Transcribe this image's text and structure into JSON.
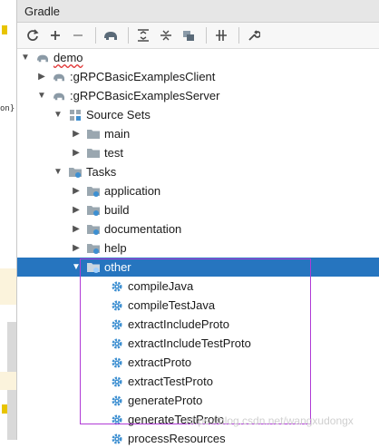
{
  "panel": {
    "title": "Gradle"
  },
  "editor": {
    "code_fragment": "on}"
  },
  "toolbar": {
    "buttons": [
      {
        "name": "refresh-icon",
        "glyph": "⟳"
      },
      {
        "name": "add-icon",
        "glyph": "+"
      },
      {
        "name": "remove-icon",
        "glyph": "−"
      },
      {
        "name": "elephant-icon",
        "glyph": "🐘"
      },
      {
        "name": "expand-all-icon",
        "glyph": "⇳"
      },
      {
        "name": "collapse-all-icon",
        "glyph": "⇕"
      },
      {
        "name": "group-modules-icon",
        "glyph": "▦"
      },
      {
        "name": "toggle-offline-icon",
        "glyph": "⇹"
      },
      {
        "name": "settings-wrench-icon",
        "glyph": "🔧"
      }
    ]
  },
  "tree": {
    "root": "demo",
    "project_client": ":gRPCBasicExamplesClient",
    "project_server": ":gRPCBasicExamplesServer",
    "source_sets": "Source Sets",
    "source_main": "main",
    "source_test": "test",
    "tasks": "Tasks",
    "task_groups": [
      "application",
      "build",
      "documentation",
      "help"
    ],
    "selected_group": "other",
    "other_tasks": [
      "compileJava",
      "compileTestJava",
      "extractIncludeProto",
      "extractIncludeTestProto",
      "extractProto",
      "extractTestProto",
      "generateProto",
      "generateTestProto",
      "processResources"
    ]
  },
  "watermark": "https://blog.csdn.net/wangxudongx",
  "colors": {
    "selection": "#2675bf",
    "highlight_box": "#b03bd6",
    "folder": "#9aa7b0",
    "gear": "#3d8fd1"
  }
}
